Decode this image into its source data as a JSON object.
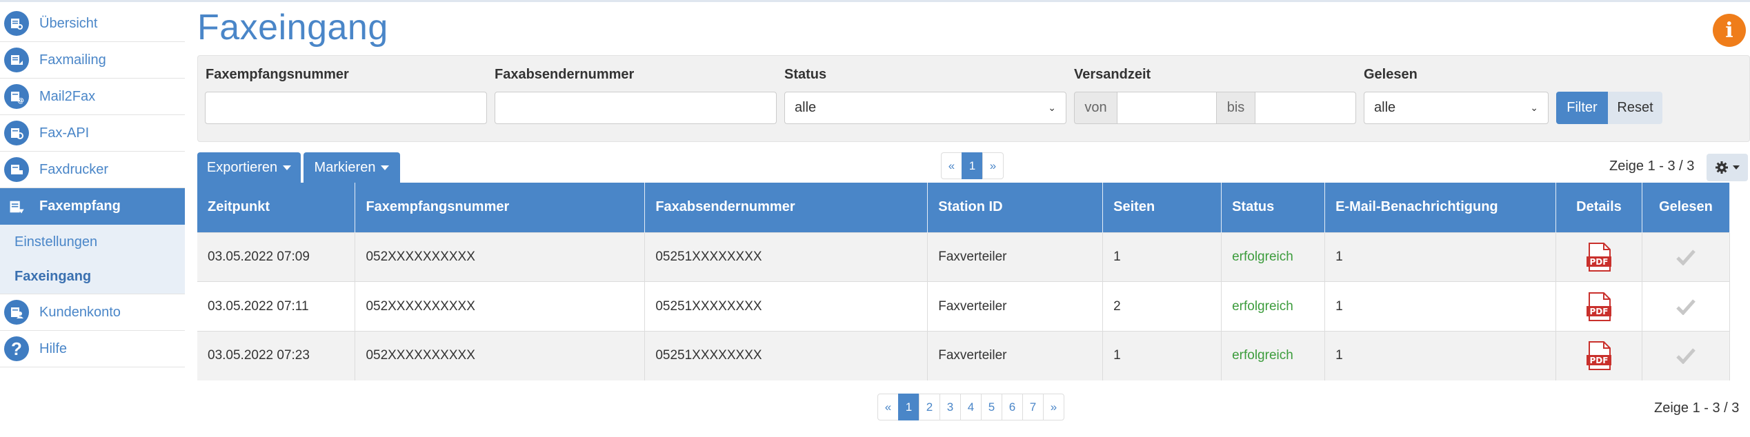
{
  "sidebar": {
    "items": [
      {
        "label": "Übersicht",
        "icon": "overview-icon"
      },
      {
        "label": "Faxmailing",
        "icon": "faxmailing-icon"
      },
      {
        "label": "Mail2Fax",
        "icon": "mail2fax-icon"
      },
      {
        "label": "Fax-API",
        "icon": "fax-api-icon"
      },
      {
        "label": "Faxdrucker",
        "icon": "faxdrucker-icon"
      },
      {
        "label": "Faxempfang",
        "icon": "faxempfang-icon"
      },
      {
        "label": "Kundenkonto",
        "icon": "kundenkonto-icon"
      },
      {
        "label": "Hilfe",
        "icon": "help-icon"
      }
    ],
    "subitems": [
      {
        "label": "Einstellungen"
      },
      {
        "label": "Faxeingang"
      }
    ]
  },
  "page": {
    "title": "Faxeingang",
    "info_icon": "info-icon",
    "accent_color": "#4a86c8",
    "info_color": "#ef7d1a"
  },
  "filters": {
    "empfangsnummer_label": "Faxempfangsnummer",
    "empfangsnummer_value": "",
    "absendernummer_label": "Faxabsendernummer",
    "absendernummer_value": "",
    "status_label": "Status",
    "status_value": "alle",
    "versandzeit_label": "Versandzeit",
    "von_label": "von",
    "von_value": "",
    "bis_label": "bis",
    "bis_value": "",
    "gelesen_label": "Gelesen",
    "gelesen_value": "alle",
    "filter_button": "Filter",
    "reset_button": "Reset"
  },
  "toolbar": {
    "export_label": "Exportieren",
    "mark_label": "Markieren",
    "range_top": "Zeige 1 - 3 / 3",
    "range_bottom": "Zeige 1 - 3 / 3",
    "settings_icon": "gear-icon"
  },
  "pager_top": {
    "prev": "«",
    "pages": [
      "1"
    ],
    "next": "»",
    "active": "1"
  },
  "pager_bottom": {
    "prev": "«",
    "pages": [
      "1",
      "2",
      "3",
      "4",
      "5",
      "6",
      "7"
    ],
    "next": "»",
    "active": "1"
  },
  "table": {
    "columns": [
      "Zeitpunkt",
      "Faxempfangsnummer",
      "Faxabsendernummer",
      "Station ID",
      "Seiten",
      "Status",
      "E-Mail-Benachrichtigung",
      "Details",
      "Gelesen"
    ],
    "rows": [
      {
        "zeitpunkt": "03.05.2022 07:09",
        "empfang": "052XXXXXXXXXX",
        "absender": "05251XXXXXXXX",
        "station": "Faxverteiler",
        "seiten": "1",
        "status": "erfolgreich",
        "email": "1",
        "details": "PDF",
        "gelesen": "check-icon"
      },
      {
        "zeitpunkt": "03.05.2022 07:11",
        "empfang": "052XXXXXXXXXX",
        "absender": "05251XXXXXXXX",
        "station": "Faxverteiler",
        "seiten": "2",
        "status": "erfolgreich",
        "email": "1",
        "details": "PDF",
        "gelesen": "check-icon"
      },
      {
        "zeitpunkt": "03.05.2022 07:23",
        "empfang": "052XXXXXXXXXX",
        "absender": "05251XXXXXXXX",
        "station": "Faxverteiler",
        "seiten": "1",
        "status": "erfolgreich",
        "email": "1",
        "details": "PDF",
        "gelesen": "check-icon"
      }
    ]
  }
}
